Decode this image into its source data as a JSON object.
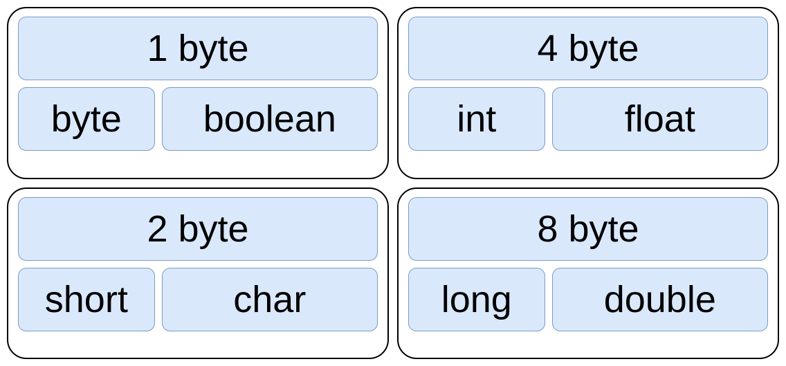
{
  "groups": [
    {
      "header": "1 byte",
      "types": [
        "byte",
        "boolean"
      ]
    },
    {
      "header": "4 byte",
      "types": [
        "int",
        "float"
      ]
    },
    {
      "header": "2 byte",
      "types": [
        "short",
        "char"
      ]
    },
    {
      "header": "8 byte",
      "types": [
        "long",
        "double"
      ]
    }
  ]
}
